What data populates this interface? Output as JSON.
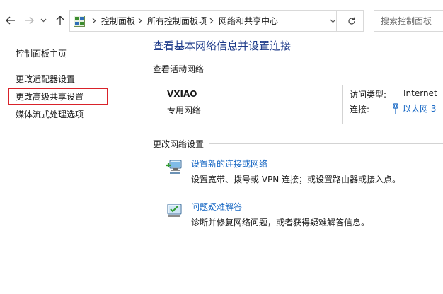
{
  "address_bar": {
    "crumbs": [
      "控制面板",
      "所有控制面板项",
      "网络和共享中心"
    ]
  },
  "search": {
    "placeholder": "搜索控制面板"
  },
  "left_pane": {
    "items": [
      {
        "label": "控制面板主页"
      },
      {
        "label": "更改适配器设置"
      },
      {
        "label": "更改高级共享设置"
      },
      {
        "label": "媒体流式处理选项"
      }
    ]
  },
  "main": {
    "title": "查看基本网络信息并设置连接",
    "active_section": "查看活动网络",
    "network": {
      "name": "VXIAO",
      "type": "专用网络",
      "access_label": "访问类型:",
      "access_value": "Internet",
      "connection_label": "连接:",
      "connection_value": "以太网 3"
    },
    "change_section": "更改网络设置",
    "tasks": [
      {
        "link": "设置新的连接或网络",
        "desc": "设置宽带、拨号或 VPN 连接；或设置路由器或接入点。",
        "icon": "new-connection-icon"
      },
      {
        "link": "问题疑难解答",
        "desc": "诊断并修复网络问题，或者获得疑难解答信息。",
        "icon": "troubleshoot-icon"
      }
    ]
  },
  "colors": {
    "link": "#1667c4",
    "title": "#1e3b8a",
    "highlight": "#d9222a"
  }
}
